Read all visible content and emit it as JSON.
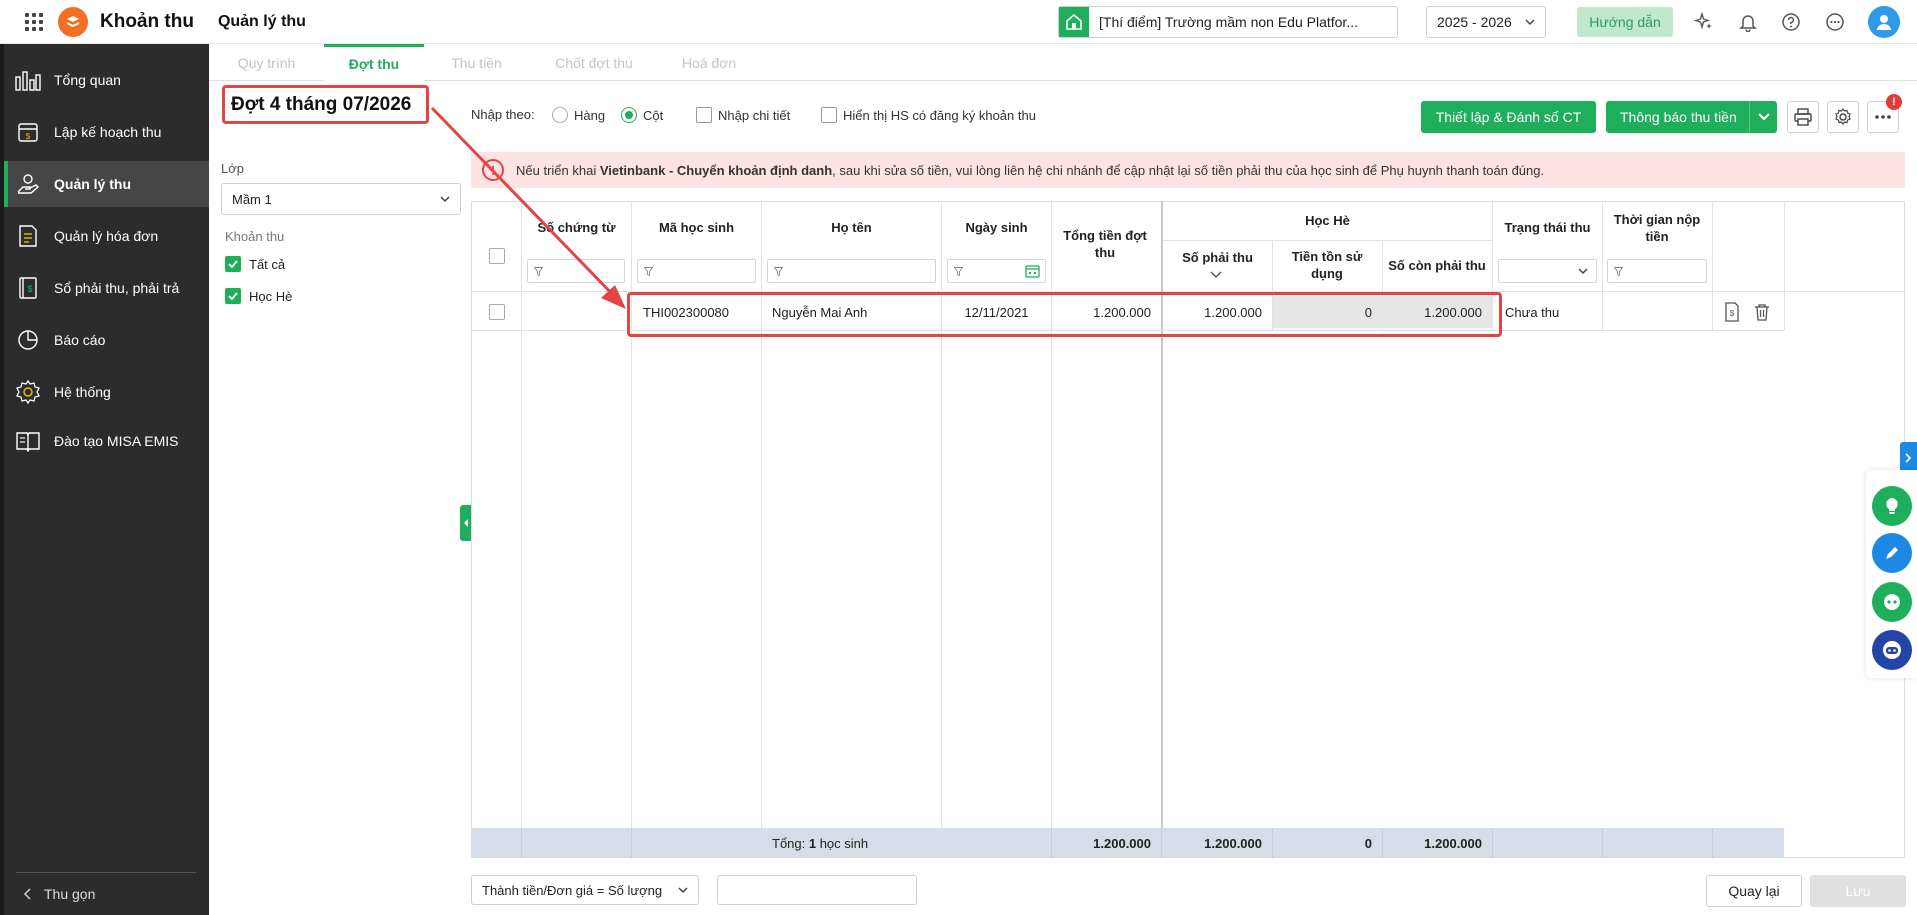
{
  "header": {
    "app_name": "Khoản thu",
    "page_name": "Quản lý thu",
    "school": "[Thí điểm] Trường mầm non Edu Platfor...",
    "year": "2025 - 2026",
    "guide": "Hướng dẫn"
  },
  "sidebar": {
    "items": [
      {
        "label": "Tổng quan",
        "icon": "chart-bars-icon"
      },
      {
        "label": "Lập kế hoạch thu",
        "icon": "calendar-money-icon"
      },
      {
        "label": "Quản lý thu",
        "icon": "hand-money-icon"
      },
      {
        "label": "Quản lý hóa đơn",
        "icon": "invoice-icon"
      },
      {
        "label": "Sổ phải thu, phải trả",
        "icon": "ledger-icon"
      },
      {
        "label": "Báo cáo",
        "icon": "pie-chart-icon"
      },
      {
        "label": "Hệ thống",
        "icon": "gear-icon"
      },
      {
        "label": "Đào tạo MISA EMIS",
        "icon": "book-icon"
      }
    ],
    "collapse": "Thu gọn"
  },
  "tabs": [
    "Quy trình",
    "Đợt thu",
    "Thu tiền",
    "Chốt đợt thu",
    "Hoá đơn"
  ],
  "left_panel": {
    "title": "Đợt 4 tháng 07/2026",
    "class_label": "Lớp",
    "class_value": "Mầm 1",
    "fees_label": "Khoản thu",
    "fees": [
      "Tất cả",
      "Học Hè"
    ]
  },
  "options": {
    "input_by": "Nhập theo:",
    "row": "Hàng",
    "column": "Cột",
    "detail": "Nhập chi tiết",
    "show_registered": "Hiển thị HS có đăng ký khoản thu",
    "setup_button": "Thiết lập & Đánh số CT",
    "notify_button": "Thông báo thu tiền",
    "alert_count": "!"
  },
  "warning": {
    "prefix": "Nếu triển khai ",
    "bold": "Vietinbank - Chuyển khoản định danh",
    "suffix": ", sau khi sửa số tiền, vui lòng liên hệ chi nhánh để cập nhật lại số tiền phải thu của học sinh để Phụ huynh thanh toán đúng."
  },
  "table": {
    "headers": {
      "doc_no": "Số chứng từ",
      "student_id": "Mã học sinh",
      "name": "Họ tên",
      "dob": "Ngày sinh",
      "total": "Tổng tiền đợt thu",
      "group": "Học Hè",
      "payable": "Số phải thu",
      "balance_used": "Tiền tồn sử dụng",
      "remaining": "Số còn phải thu",
      "status": "Trạng thái thu",
      "paid_time": "Thời gian nộp tiền"
    },
    "rows": [
      {
        "doc_no": "",
        "student_id": "THI002300080",
        "name": "Nguyễn Mai Anh",
        "dob": "12/11/2021",
        "total": "1.200.000",
        "payable": "1.200.000",
        "balance_used": "0",
        "remaining": "1.200.000",
        "status": "Chưa thu",
        "paid_time": ""
      }
    ],
    "footer": {
      "label": "Tổng: ",
      "count": "1",
      "unit": " học sinh",
      "total": "1.200.000",
      "payable": "1.200.000",
      "balance_used": "0",
      "remaining": "1.200.000"
    }
  },
  "bottom": {
    "formula": "Thành tiền/Đơn giá = Số lượng",
    "back": "Quay lại",
    "save": "Lưu"
  },
  "colors": {
    "accent": "#1fae5b",
    "sidebar": "#2c2c2c",
    "highlight": "#e14545",
    "warning_bg": "#fde3e3",
    "footer_bg": "#d6dde8"
  }
}
